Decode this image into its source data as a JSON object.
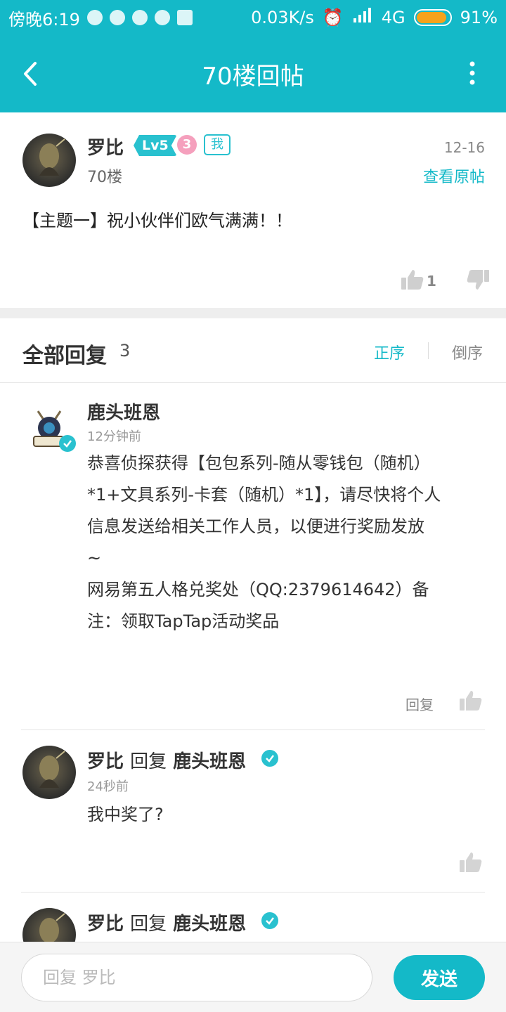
{
  "status_bar": {
    "time": "傍晚6:19",
    "net_speed": "0.03K/s",
    "network": "4G",
    "battery": "91%",
    "battery_level": 0.91
  },
  "app_bar": {
    "title": "70楼回帖",
    "back_icon": "chevron-left-icon",
    "menu_icon": "more-vertical-icon"
  },
  "post": {
    "author": "罗比",
    "level": "Lv5",
    "medal": "3",
    "me_badge": "我",
    "floor": "70楼",
    "date": "12-16",
    "view_original": "查看原帖",
    "content": "【主题一】祝小伙伴们欧气满满！！",
    "like_count": "1"
  },
  "replies": {
    "title": "全部回复",
    "count": "3",
    "sort_asc": "正序",
    "sort_desc": "倒序",
    "items": [
      {
        "author": "鹿头班恩",
        "time": "12分钟前",
        "lines": [
          "恭喜侦探获得【包包系列-随从零钱包（随机）",
          "*1+文具系列-卡套（随机）*1】，请尽快将个人",
          "信息发送给相关工作人员，以便进行奖励发放",
          "~",
          "网易第五人格兑奖处（QQ:2379614642）备",
          "注：领取TapTap活动奖品"
        ],
        "reply_label": "回复"
      },
      {
        "author": "罗比",
        "reply_word": "回复",
        "reply_to": "鹿头班恩",
        "time": "24秒前",
        "text": "我中奖了?"
      },
      {
        "author": "罗比",
        "reply_word": "回复",
        "reply_to": "鹿头班恩"
      }
    ]
  },
  "composer": {
    "placeholder": "回复 罗比",
    "send_label": "发送"
  },
  "colors": {
    "accent": "#14b9c8",
    "battery": "#f6a21b"
  }
}
